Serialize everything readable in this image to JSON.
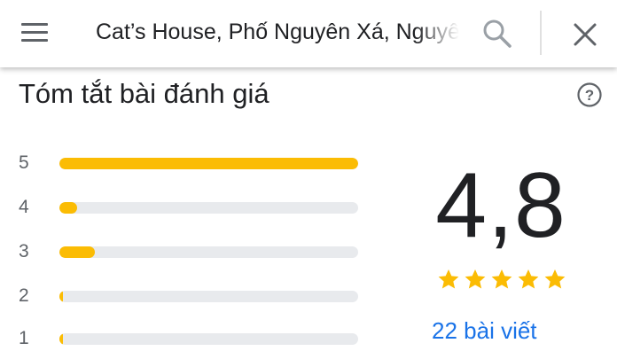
{
  "search": {
    "query": "Cat’s House, Phố Nguyên Xá, Nguyên",
    "menu_icon": "menu-icon",
    "search_icon": "search-icon",
    "close_icon": "close-icon"
  },
  "summary": {
    "title": "Tóm tắt bài đánh giá",
    "help_icon": "help-icon",
    "average": "4,8",
    "stars": 5,
    "reviews_label": "22 bài viết",
    "bars": [
      {
        "label": "5",
        "fraction": 1.0
      },
      {
        "label": "4",
        "fraction": 0.06
      },
      {
        "label": "3",
        "fraction": 0.12
      },
      {
        "label": "2",
        "fraction": 0.01
      },
      {
        "label": "1",
        "fraction": 0.01
      }
    ]
  },
  "colors": {
    "bar_fill": "#fbbc04",
    "bar_track": "#e8eaed",
    "link": "#1a73e8",
    "icon": "#5f6368"
  }
}
